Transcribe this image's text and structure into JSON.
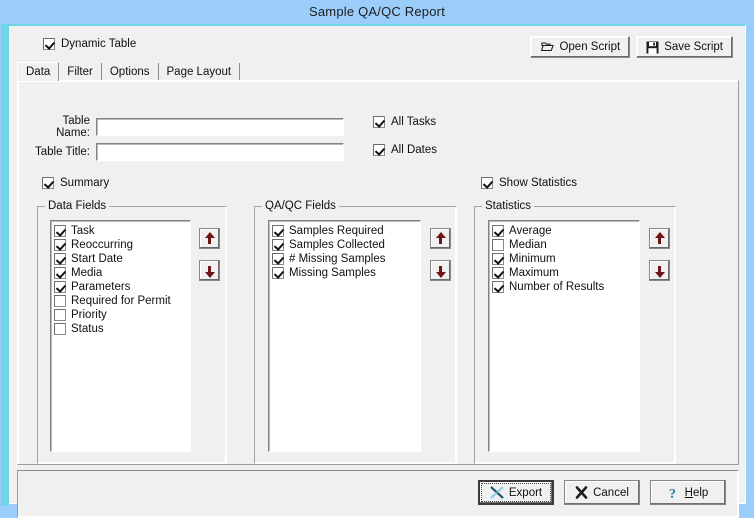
{
  "window": {
    "title": "Sample QA/QC Report",
    "titlebar_color": "#9bcdfb",
    "accent_color": "#6fd4e6",
    "face_color": "#f0f0f0",
    "arrow_color": "#6e1414"
  },
  "toolbar": {
    "dynamic_table": {
      "label": "Dynamic Table",
      "checked": true
    },
    "open_script": {
      "label": "Open Script",
      "icon": "open-folder-icon"
    },
    "save_script": {
      "label": "Save Script",
      "icon": "floppy-disk-icon"
    }
  },
  "tabs": [
    {
      "label": "Data",
      "active": true
    },
    {
      "label": "Filter",
      "active": false
    },
    {
      "label": "Options",
      "active": false
    },
    {
      "label": "Page Layout",
      "active": false
    }
  ],
  "form": {
    "table_name": {
      "label": "Table Name:",
      "value": "",
      "placeholder": ""
    },
    "table_title": {
      "label": "Table Title:",
      "value": "",
      "placeholder": ""
    },
    "all_tasks": {
      "label": "All Tasks",
      "checked": true
    },
    "all_dates": {
      "label": "All Dates",
      "checked": true
    },
    "summary": {
      "label": "Summary",
      "checked": true
    },
    "show_statistics": {
      "label": "Show Statistics",
      "checked": true
    }
  },
  "data_fields": {
    "title": "Data Fields",
    "items": [
      {
        "label": "Task",
        "checked": true
      },
      {
        "label": "Reoccurring",
        "checked": true
      },
      {
        "label": "Start Date",
        "checked": true
      },
      {
        "label": "Media",
        "checked": true
      },
      {
        "label": "Parameters",
        "checked": true
      },
      {
        "label": "Required for Permit",
        "checked": false
      },
      {
        "label": "Priority",
        "checked": false
      },
      {
        "label": "Status",
        "checked": false
      }
    ],
    "move_up": "Move Up",
    "move_down": "Move Down"
  },
  "qaqc_fields": {
    "title": "QA/QC Fields",
    "items": [
      {
        "label": "Samples Required",
        "checked": true
      },
      {
        "label": "Samples Collected",
        "checked": true
      },
      {
        "label": "# Missing Samples",
        "checked": true
      },
      {
        "label": "Missing Samples",
        "checked": true
      }
    ],
    "move_up": "Move Up",
    "move_down": "Move Down"
  },
  "statistics": {
    "title": "Statistics",
    "items": [
      {
        "label": "Average",
        "checked": true
      },
      {
        "label": "Median",
        "checked": false
      },
      {
        "label": "Minimum",
        "checked": true
      },
      {
        "label": "Maximum",
        "checked": true
      },
      {
        "label": "Number of Results",
        "checked": true
      }
    ],
    "move_up": "Move Up",
    "move_down": "Move Down"
  },
  "footer": {
    "export": {
      "label": "Export",
      "icon": "excel-x-icon",
      "default": true
    },
    "cancel": {
      "label": "Cancel",
      "icon": "x-mark-icon"
    },
    "help": {
      "label": "Help",
      "accel": "H",
      "icon": "question-mark-icon"
    }
  }
}
